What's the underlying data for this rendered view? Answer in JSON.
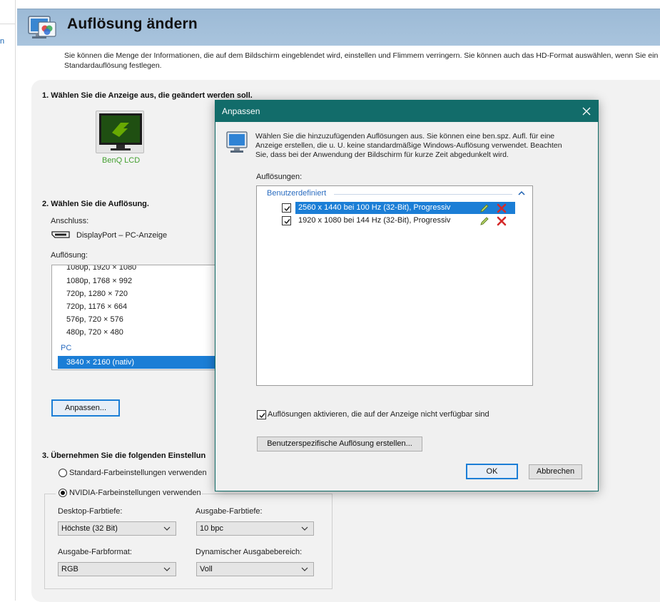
{
  "sidebar": {
    "link_fragment": "n"
  },
  "header": {
    "title": "Auflösung ändern"
  },
  "description": "Sie können die Menge der Informationen, die auf dem Bildschirm eingeblendet wird, einstellen und Flimmern verringern. Sie können auch das HD-Format auswählen, wenn Sie ein Standardauflösung festlegen.",
  "section1": {
    "title": "1. Wählen Sie die Anzeige aus, die geändert werden soll.",
    "monitor_name": "BenQ LCD"
  },
  "section2": {
    "title": "2. Wählen Sie die Auflösung.",
    "connection_label": "Anschluss:",
    "connection_value": "DisplayPort – PC-Anzeige",
    "resolution_label": "Auflösung:",
    "resolutions": [
      "1080p, 1920 × 1080",
      "1080p, 1768 × 992",
      "720p, 1280 × 720",
      "720p, 1176 × 664",
      "576p, 720 × 576",
      "480p, 720 × 480"
    ],
    "group_pc": "PC",
    "selected_resolution": "3840 × 2160 (nativ)",
    "customize_button": "Anpassen..."
  },
  "section3": {
    "title": "3. Übernehmen Sie die folgenden Einstellun",
    "radio_standard": "Standard-Farbeinstellungen verwenden",
    "radio_nvidia": "NVIDIA-Farbeinstellungen verwenden",
    "desktop_depth_label": "Desktop-Farbtiefe:",
    "desktop_depth_value": "Höchste (32 Bit)",
    "output_depth_label": "Ausgabe-Farbtiefe:",
    "output_depth_value": "10 bpc",
    "output_format_label": "Ausgabe-Farbformat:",
    "output_format_value": "RGB",
    "dynamic_range_label": "Dynamischer Ausgabebereich:",
    "dynamic_range_value": "Voll"
  },
  "dialog": {
    "title": "Anpassen",
    "text": "Wählen Sie die hinzuzufügenden Auflösungen aus. Sie können eine ben.spz. Aufl. für eine Anzeige erstellen, die u. U. keine standardmäßige Windows-Auflösung verwendet. Beachten Sie, dass bei der Anwendung der Bildschirm für kurze Zeit abgedunkelt wird.",
    "list_label": "Auflösungen:",
    "group_label": "Benutzerdefiniert",
    "rows": [
      "2560 x 1440 bei 100 Hz (32-Bit), Progressiv",
      "1920 x 1080 bei 144 Hz (32-Bit), Progressiv"
    ],
    "enable_checkbox": "Auflösungen aktivieren, die auf der Anzeige nicht verfügbar sind",
    "create_button": "Benutzerspezifische Auflösung erstellen...",
    "ok_button": "OK",
    "cancel_button": "Abbrechen"
  }
}
